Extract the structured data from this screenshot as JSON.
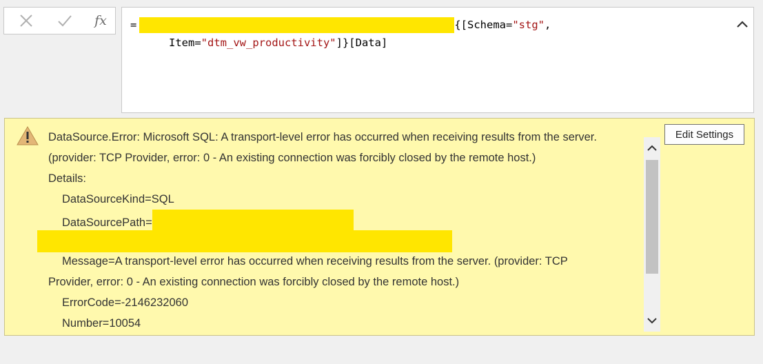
{
  "formula_bar": {
    "cancel_icon": "x-icon",
    "commit_icon": "checkmark-icon",
    "fx_label": "fx",
    "formula": {
      "prefix": "=",
      "line1_suffix_open": "{[Schema=",
      "schema_value": "\"stg\"",
      "line1_suffix_close": ",",
      "line2_key": "Item=",
      "item_value": "\"dtm_vw_productivity\"",
      "line2_suffix": "]}[Data]"
    },
    "collapse_icon": "chevron-up-icon"
  },
  "error_panel": {
    "warning_icon": "warning-triangle-icon",
    "lines": {
      "l1": "DataSource.Error: Microsoft SQL: A transport-level error has occurred when receiving results from the server.",
      "l2": "(provider: TCP Provider, error: 0 - An existing connection was forcibly closed by the remote host.)",
      "l3": "Details:",
      "l4": "DataSourceKind=SQL",
      "l5": "DataSourcePath=",
      "l7": "Message=A transport-level error has occurred when receiving results from the server. (provider: TCP",
      "l8": "Provider, error: 0 - An existing connection was forcibly closed by the remote host.)",
      "l9": "ErrorCode=-2146232060",
      "l10": "Number=10054"
    },
    "edit_settings_label": "Edit Settings",
    "redaction_color": "#ffe600",
    "background_color": "#fff9ad"
  }
}
